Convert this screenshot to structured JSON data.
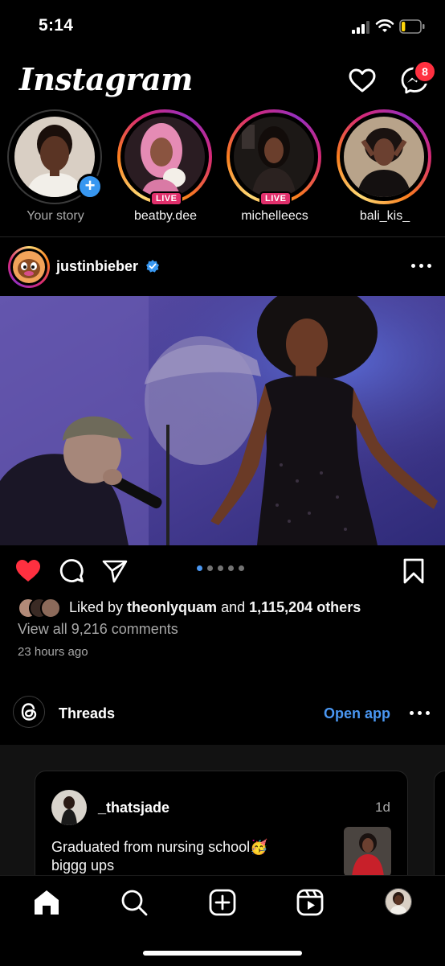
{
  "status": {
    "time": "5:14",
    "battery_level": 0.2
  },
  "header": {
    "logo": "Instagram",
    "messages_badge": "8"
  },
  "stories": [
    {
      "label": "Your story",
      "live": false,
      "own": true
    },
    {
      "label": "beatby.dee",
      "live": true,
      "live_label": "LIVE"
    },
    {
      "label": "michelleecs",
      "live": true,
      "live_label": "LIVE"
    },
    {
      "label": "bali_kis_",
      "live": false
    }
  ],
  "post": {
    "username": "justinbieber",
    "verified": true,
    "carousel": {
      "count": 5,
      "active": 0
    },
    "liked": true,
    "likes": {
      "prefix": "Liked by ",
      "user": "theonlyquam",
      "middle": " and ",
      "others": "1,115,204 others"
    },
    "comments_link": "View all 9,216 comments",
    "time": "23 hours ago"
  },
  "threads": {
    "title": "Threads",
    "open_app": "Open app",
    "card": {
      "username": "_thatsjade",
      "age": "1d",
      "text_line1": "Graduated from nursing school🥳",
      "text_line2": "biggg ups"
    }
  },
  "colors": {
    "accent_blue": "#4a97f2",
    "like_red": "#ff3040",
    "live_pink": "#e1306c"
  },
  "icons": {
    "header": [
      "heart-icon",
      "messenger-icon"
    ],
    "actions": [
      "heart-filled-icon",
      "comment-icon",
      "share-icon",
      "bookmark-icon"
    ],
    "nav": [
      "home-icon",
      "search-icon",
      "new-post-icon",
      "reels-icon",
      "profile-avatar"
    ]
  }
}
